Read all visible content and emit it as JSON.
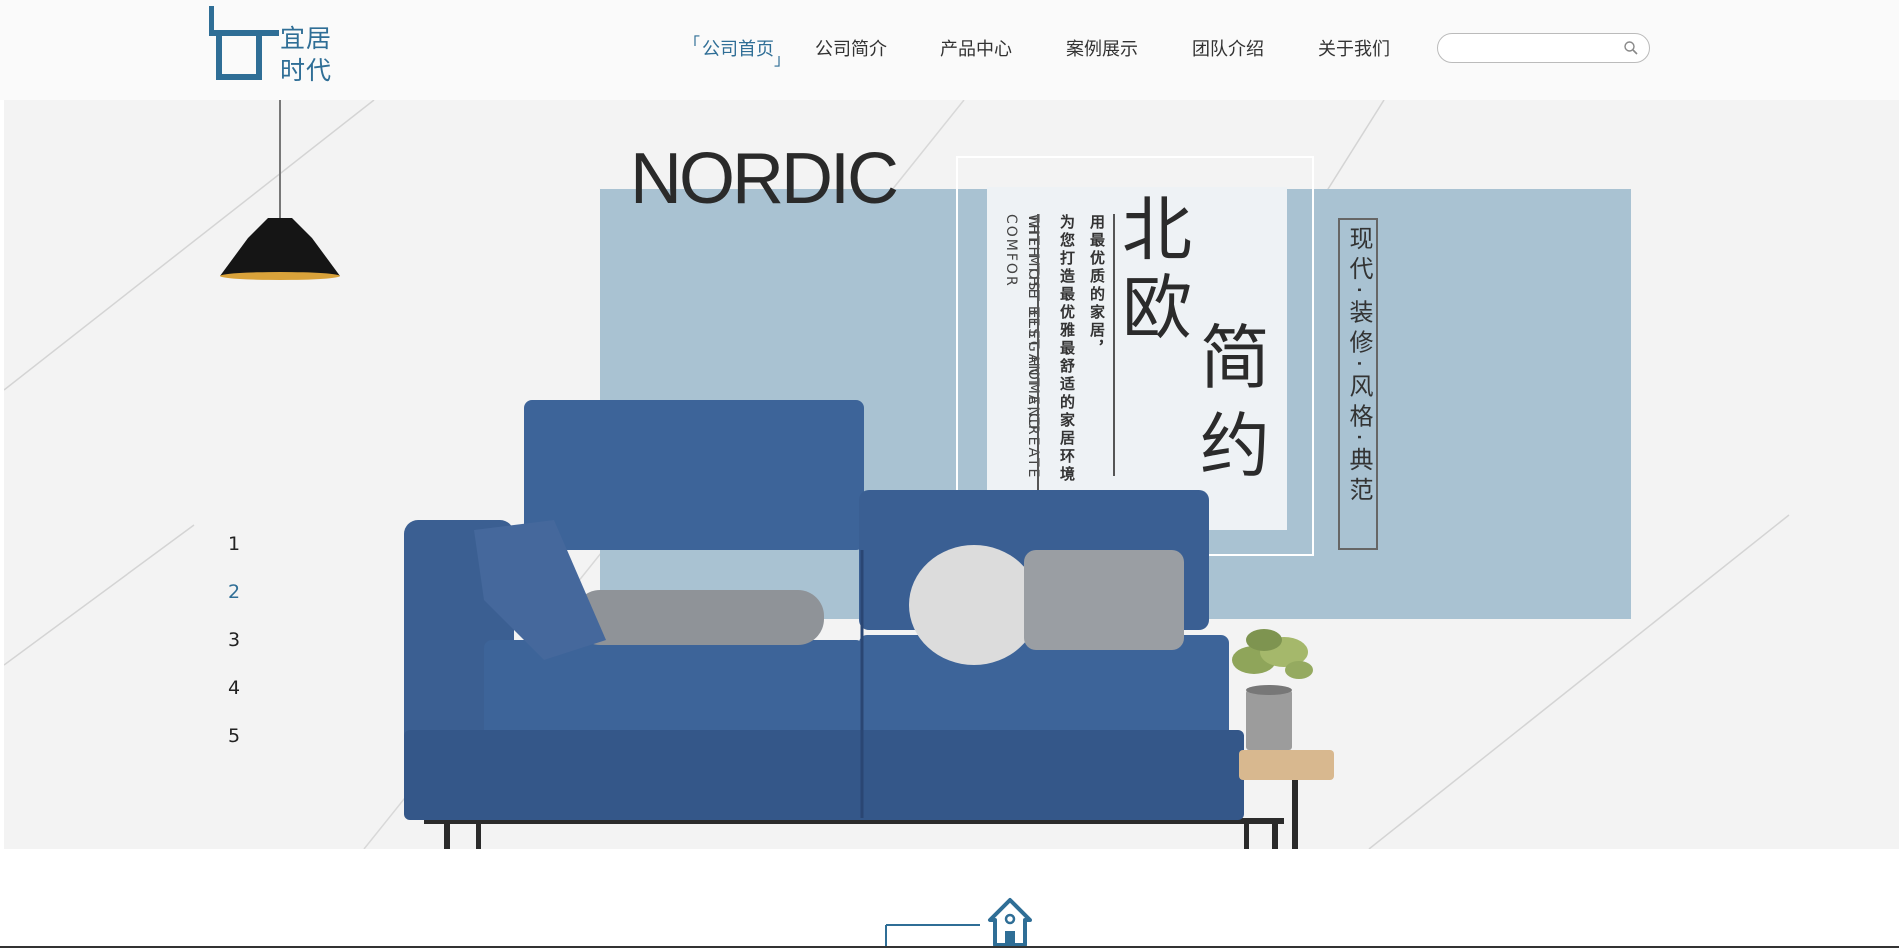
{
  "header": {
    "logo_text": [
      "宜居",
      "时代"
    ],
    "nav": [
      {
        "label": "公司首页",
        "active": true
      },
      {
        "label": "公司简介",
        "active": false
      },
      {
        "label": "产品中心",
        "active": false
      },
      {
        "label": "案例展示",
        "active": false
      },
      {
        "label": "团队介绍",
        "active": false
      },
      {
        "label": "关于我们",
        "active": false
      }
    ],
    "bracket_open": "「",
    "bracket_close": "」",
    "search": {
      "value": "",
      "placeholder": "",
      "icon": "search-icon"
    }
  },
  "banner": {
    "nordic": "NORDIC",
    "title_chars": [
      "北",
      "欧",
      "简",
      "约"
    ],
    "slogan_cn_1": "用最优质的家居，",
    "slogan_cn_2": "为您打造最优雅最舒适的家居环境",
    "slogan_en_1": "WITH THE BEST HOME,CREATE",
    "slogan_en_2": "THE MOST ELEGANT AND COMFOR",
    "side_text": "现代·装修·风格·典范",
    "pager": [
      "1",
      "2",
      "3",
      "4",
      "5"
    ],
    "pager_active": "2"
  },
  "colors": {
    "accent": "#2f6e96",
    "panel": "#a9c2d2",
    "sofa": "#3b5f92"
  }
}
